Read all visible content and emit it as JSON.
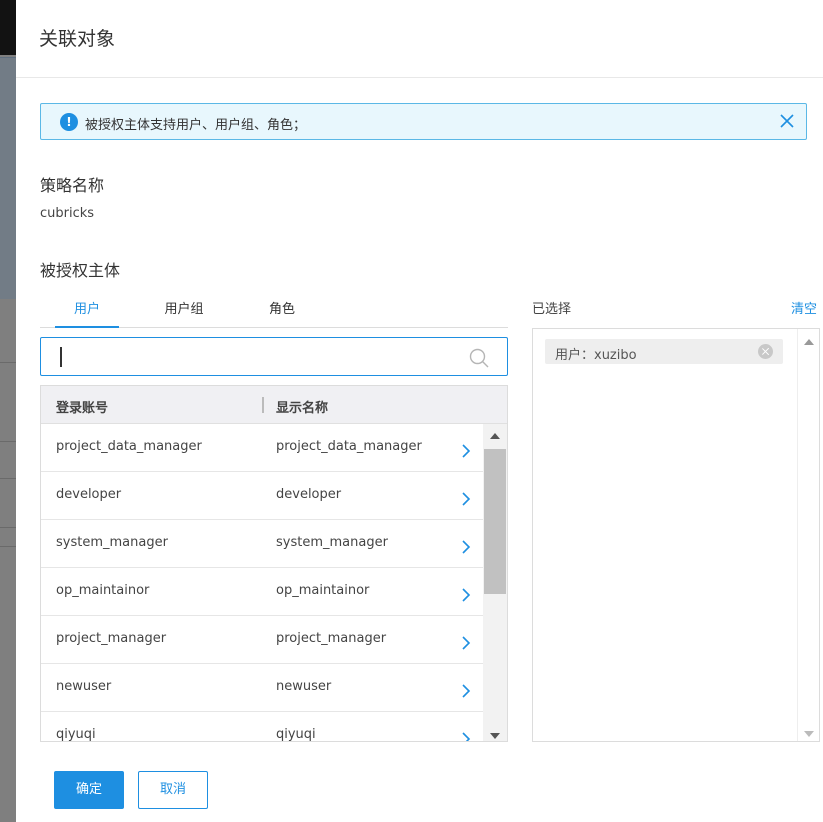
{
  "dialog": {
    "title": "关联对象",
    "alert_text": "被授权主体支持用户、用户组、角色；",
    "policy_name_label": "策略名称",
    "policy_name_value": "cubricks",
    "principal_label": "被授权主体"
  },
  "tabs": [
    {
      "label": "用户",
      "active": true
    },
    {
      "label": "用户组",
      "active": false
    },
    {
      "label": "角色",
      "active": false
    }
  ],
  "search": {
    "value": "",
    "placeholder": ""
  },
  "table": {
    "headers": [
      "登录账号",
      "显示名称"
    ],
    "rows": [
      [
        "project_data_manager",
        "project_data_manager"
      ],
      [
        "developer",
        "developer"
      ],
      [
        "system_manager",
        "system_manager"
      ],
      [
        "op_maintainor",
        "op_maintainor"
      ],
      [
        "project_manager",
        "project_manager"
      ],
      [
        "newuser",
        "newuser"
      ],
      [
        "qiyuqi",
        "qiyuqi"
      ]
    ]
  },
  "selected": {
    "label": "已选择",
    "clear_label": "清空",
    "items": [
      "用户：xuzibo"
    ]
  },
  "footer": {
    "ok_label": "确定",
    "cancel_label": "取消"
  },
  "colors": {
    "accent": "#1e8fe1",
    "alert_bg": "#e8f7fd"
  }
}
